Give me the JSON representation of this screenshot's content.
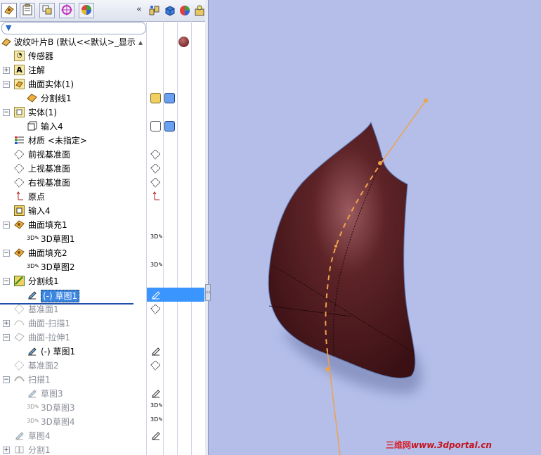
{
  "panel": {
    "collapse_label": "«",
    "tabs": [
      {
        "icon": "feature-manager-icon"
      },
      {
        "icon": "property-manager-icon"
      },
      {
        "icon": "configuration-manager-icon"
      },
      {
        "icon": "dimxpert-icon"
      },
      {
        "icon": "display-manager-icon"
      }
    ],
    "top_icons": [
      "hide-show-icon",
      "view-solids-icon",
      "appearance-icon",
      "lights-icon"
    ],
    "filter_placeholder": ""
  },
  "tree": {
    "rows": [
      {
        "label": "波纹叶片B  (默认<<默认>_显示",
        "icon": "part-icon",
        "dim": false
      },
      {
        "label": "传感器",
        "icon": "sensor-icon",
        "dim": false
      },
      {
        "label": "注解",
        "icon": "annotation-icon",
        "dim": false
      },
      {
        "label": "曲面实体(1)",
        "icon": "surface-bodies-icon",
        "dim": false
      },
      {
        "label": "分割线1",
        "icon": "surface-body-icon",
        "dim": false
      },
      {
        "label": "实体(1)",
        "icon": "solid-bodies-icon",
        "dim": false
      },
      {
        "label": "输入4",
        "icon": "solid-body-icon",
        "dim": false
      },
      {
        "label": "材质 <未指定>",
        "icon": "material-icon",
        "dim": false
      },
      {
        "label": "前视基准面",
        "icon": "plane-icon",
        "dim": false
      },
      {
        "label": "上视基准面",
        "icon": "plane-icon",
        "dim": false
      },
      {
        "label": "右视基准面",
        "icon": "plane-icon",
        "dim": false
      },
      {
        "label": "原点",
        "icon": "origin-icon",
        "dim": false
      },
      {
        "label": "输入4",
        "icon": "imported-feature-icon",
        "dim": false
      },
      {
        "label": "曲面填充1",
        "icon": "fill-surface-icon",
        "dim": false
      },
      {
        "label": "3D草图1",
        "icon": "3d-sketch-icon",
        "dim": false
      },
      {
        "label": "曲面填充2",
        "icon": "fill-surface-icon",
        "dim": false
      },
      {
        "label": "3D草图2",
        "icon": "3d-sketch-icon",
        "dim": false
      },
      {
        "label": "分割线1",
        "icon": "split-line-icon",
        "dim": false
      },
      {
        "label": "(-) 草图1",
        "icon": "sketch-icon",
        "dim": false
      },
      {
        "label": "基准面1",
        "icon": "plane-icon",
        "dim": true
      },
      {
        "label": "曲面-扫描1",
        "icon": "swept-surface-icon",
        "dim": true
      },
      {
        "label": "曲面-拉伸1",
        "icon": "extruded-surface-icon",
        "dim": true
      },
      {
        "label": "(-) 草图1",
        "icon": "sketch-icon",
        "dim": false
      },
      {
        "label": "基准面2",
        "icon": "plane-icon",
        "dim": true
      },
      {
        "label": "扫描1",
        "icon": "sweep-icon",
        "dim": true
      },
      {
        "label": "草图3",
        "icon": "sketch-icon",
        "dim": true
      },
      {
        "label": "3D草图3",
        "icon": "3d-sketch-icon",
        "dim": true
      },
      {
        "label": "3D草图4",
        "icon": "3d-sketch-icon",
        "dim": true
      },
      {
        "label": "草图4",
        "icon": "sketch-icon",
        "dim": true
      },
      {
        "label": "分割1",
        "icon": "split-icon",
        "dim": true
      }
    ]
  },
  "watermark": {
    "cn": "三维网",
    "url": "www.3dportal.cn"
  },
  "colors": {
    "viewport_bg": "#b4bee9",
    "model": "#4a1a1c",
    "curve": "#f0a24a",
    "selection": "#3a86e0"
  }
}
